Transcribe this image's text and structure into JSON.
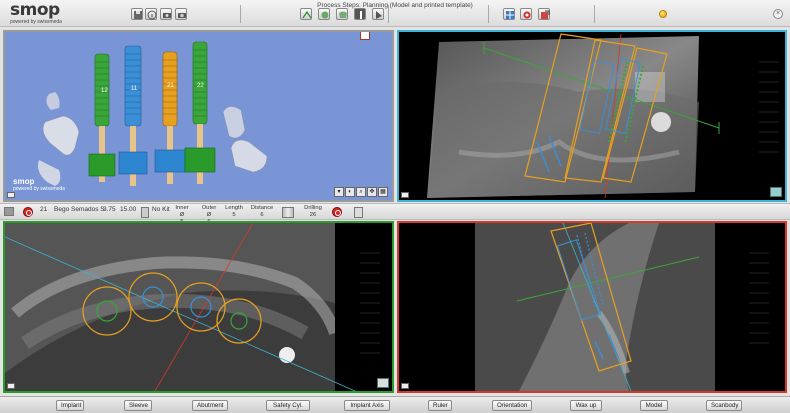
{
  "app": {
    "logo_word": "smop",
    "logo_tagline": "powered by swissmeda",
    "process_title": "Process Steps: Planning (Model and printed template)"
  },
  "viewport_3d": {
    "brand_word": "smop",
    "brand_tagline": "powered by swissmeda",
    "implant_labels": [
      "12",
      "11",
      "21",
      "22"
    ],
    "colors": {
      "background": "#7a95d6",
      "implant_green": "#3aa63a",
      "implant_blue": "#3b8fd6",
      "implant_orange": "#e8a020",
      "sleeve_green": "#2a9a2a",
      "sleeve_blue": "#2f86d0"
    }
  },
  "infobar": {
    "tooth": "21",
    "implant_name": "Bego Semados S",
    "diameter": "3.75",
    "length": "15.00",
    "kit": "No Kit",
    "inner_label": "Inner Ø",
    "inner_value": "5",
    "outer_label": "Outer Ø",
    "outer_value": "6",
    "len_label": "Length",
    "len_value": "5",
    "dist_label": "Distance",
    "dist_value": "6",
    "drill_label": "Drilling",
    "drill_value": "26"
  },
  "bottom_toolbar": {
    "implant": "Implant",
    "sleeve": "Sleeve",
    "abutment": "Abutment",
    "safety": "Safety Cyl.",
    "axis": "Implant Axis",
    "ruler": "Ruler",
    "orientation": "Orientation",
    "waxup": "Wax up",
    "model": "Model",
    "scanbody": "Scanbody"
  },
  "view_frame_colors": {
    "sagittal": "#3db4d6",
    "axial": "#2a9a2a",
    "cross_section": "#d33a2a"
  }
}
